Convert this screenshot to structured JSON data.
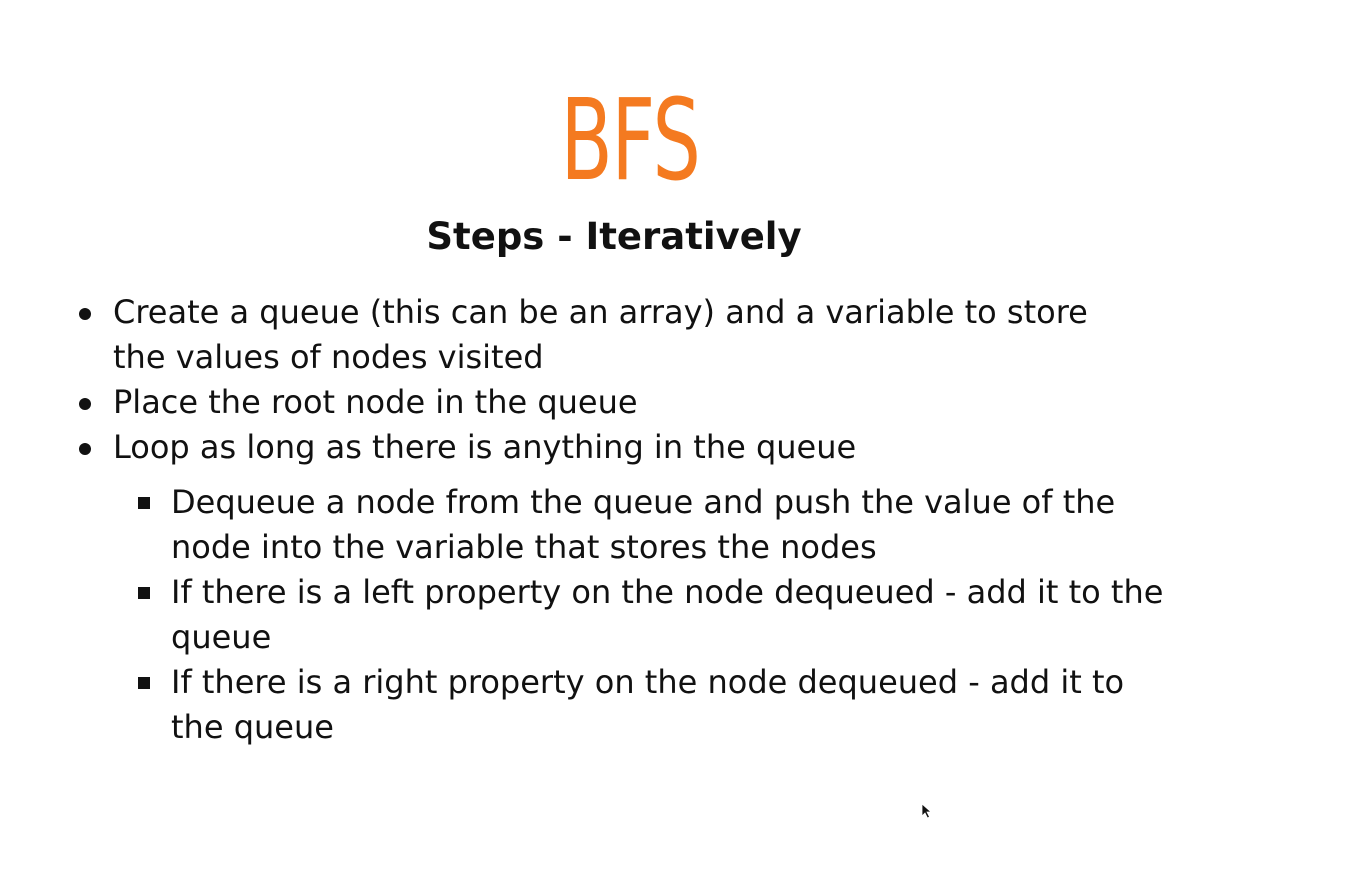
{
  "slide": {
    "title": "BFS",
    "subtitle": "Steps - Iteratively",
    "bullets": [
      "Create a queue (this can be an array) and a variable to store the values of nodes visited",
      "Place the root node in the queue",
      "Loop as long as there is anything in the queue"
    ],
    "sub_bullets": [
      "Dequeue a node from the queue and push the value of the node into the variable that stores the nodes",
      "If there is a left property on the node dequeued - add it to the queue",
      "If there is a right property on the node dequeued - add it to the queue"
    ]
  },
  "colors": {
    "title": "#f47a20",
    "text": "#111111",
    "background": "#ffffff"
  },
  "icons": {
    "cursor": "mouse-pointer-icon"
  }
}
